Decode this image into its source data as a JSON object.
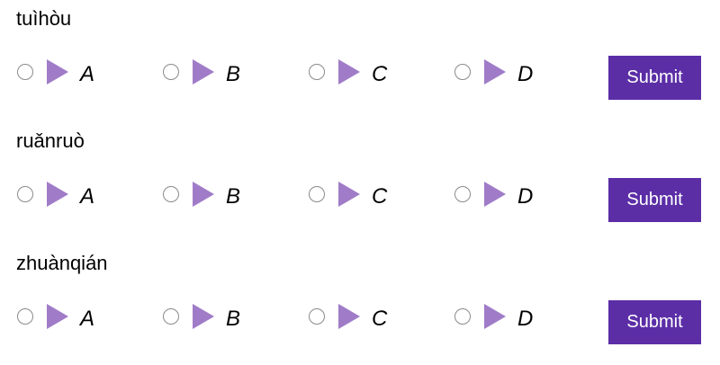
{
  "accent_color": "#5b2ea6",
  "play_icon_color": "#a07cc8",
  "questions": [
    {
      "word": "tuìhòu",
      "options": [
        {
          "label": "A",
          "icon": "play-icon"
        },
        {
          "label": "B",
          "icon": "play-icon"
        },
        {
          "label": "C",
          "icon": "play-icon"
        },
        {
          "label": "D",
          "icon": "play-icon"
        }
      ],
      "submit_label": "Submit"
    },
    {
      "word": "ruǎnruò",
      "options": [
        {
          "label": "A",
          "icon": "play-icon"
        },
        {
          "label": "B",
          "icon": "play-icon"
        },
        {
          "label": "C",
          "icon": "play-icon"
        },
        {
          "label": "D",
          "icon": "play-icon"
        }
      ],
      "submit_label": "Submit"
    },
    {
      "word": "zhuànqián",
      "options": [
        {
          "label": "A",
          "icon": "play-icon"
        },
        {
          "label": "B",
          "icon": "play-icon"
        },
        {
          "label": "C",
          "icon": "play-icon"
        },
        {
          "label": "D",
          "icon": "play-icon"
        }
      ],
      "submit_label": "Submit"
    }
  ]
}
